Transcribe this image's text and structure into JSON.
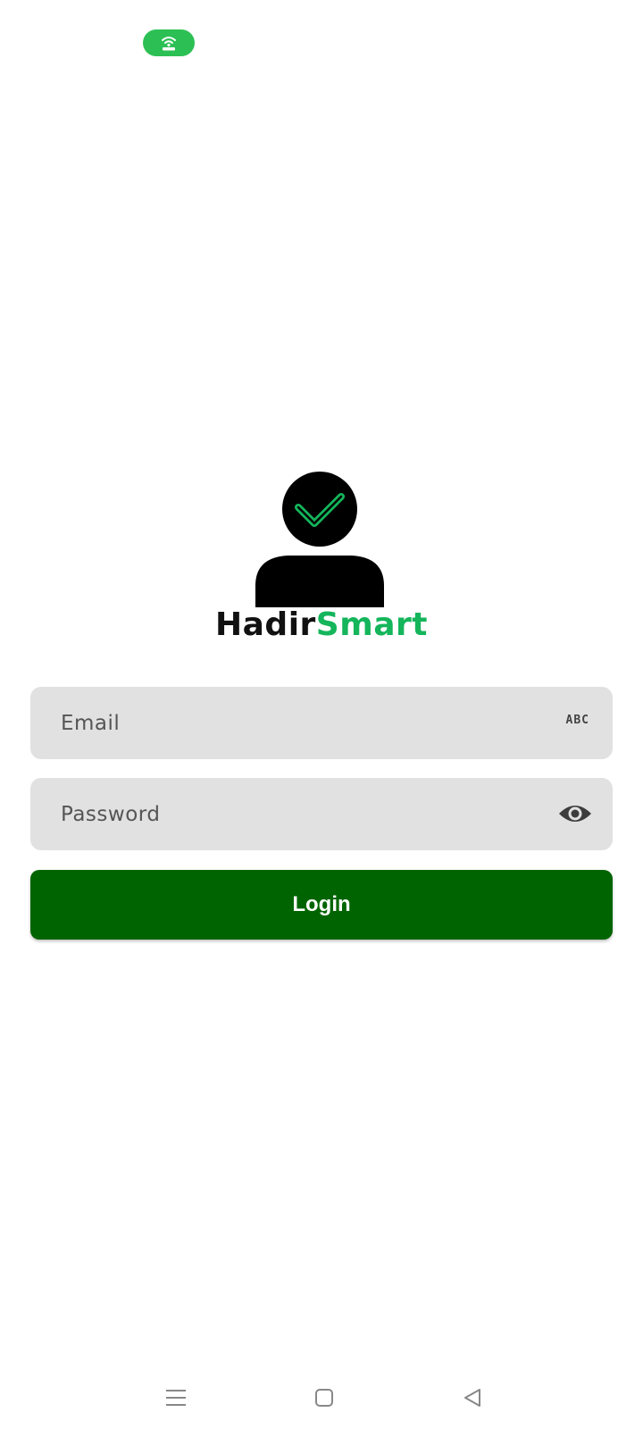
{
  "status_bar": {
    "hotspot_icon": "hotspot-icon",
    "pill_color": "#2cc054"
  },
  "logo": {
    "brand_part_1": "Hadir",
    "brand_part_2": "Smart",
    "brand_color_dark": "#111111",
    "brand_color_accent": "#14b55b"
  },
  "form": {
    "email_placeholder": "Email",
    "email_value": "",
    "email_trailing_icon": "abc-keyboard-icon",
    "email_trailing_label": "ABC",
    "password_placeholder": "Password",
    "password_value": "",
    "password_trailing_icon": "eye-icon",
    "login_label": "Login",
    "login_color": "#006400"
  },
  "nav_bar": {
    "items": [
      "menu-icon",
      "home-square-icon",
      "back-triangle-icon"
    ]
  }
}
